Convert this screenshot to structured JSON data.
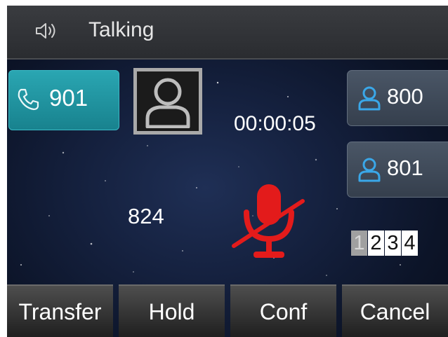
{
  "status": {
    "title": "Talking",
    "icon": "speaker-icon"
  },
  "line_key": {
    "label": "901",
    "icon": "phone-handset-icon",
    "color": "#1f96a2"
  },
  "call": {
    "avatar_icon": "contact-avatar-icon",
    "duration": "00:00:05",
    "caller": "824",
    "mute_icon": "microphone-muted-icon",
    "mute_color": "#e31b1b"
  },
  "contacts": [
    {
      "label": "800",
      "icon": "person-icon"
    },
    {
      "label": "801",
      "icon": "person-icon"
    }
  ],
  "pages": {
    "items": [
      "1",
      "2",
      "3",
      "4"
    ],
    "active": "1"
  },
  "softkeys": [
    "Transfer",
    "Hold",
    "Conf",
    "Cancel"
  ]
}
